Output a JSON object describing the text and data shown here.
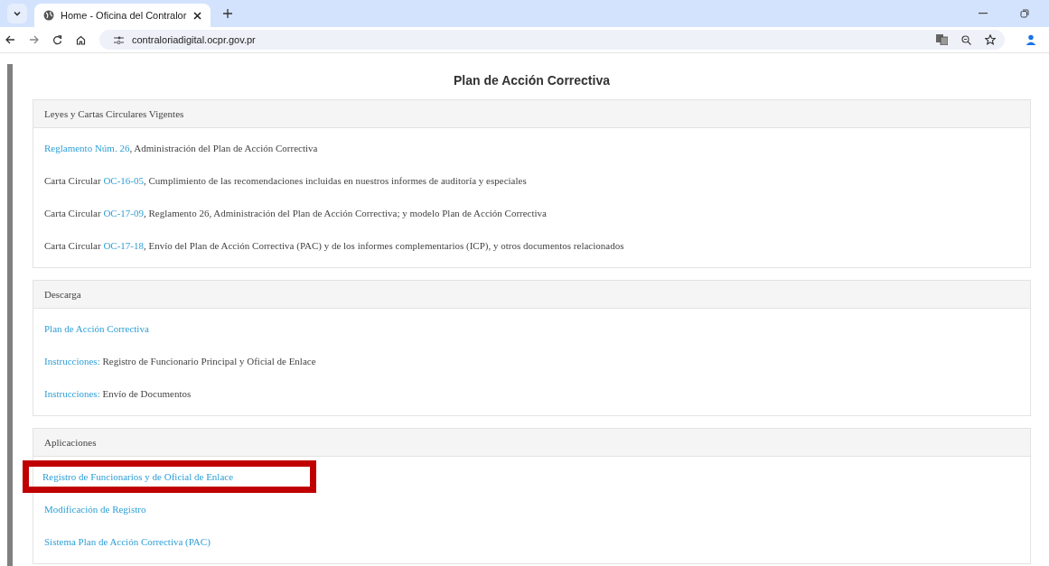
{
  "browser": {
    "tab": {
      "title": "Home - Oficina del Contralor",
      "selected": true
    },
    "url": "contraloriadigital.ocpr.gov.pr"
  },
  "page_title": "Plan de Acción Correctiva",
  "sections": [
    {
      "heading": "Leyes y Cartas Circulares Vigentes",
      "items": [
        {
          "link": "Reglamento Núm. 26",
          "text": ", Administración del Plan de Acción Correctiva",
          "highlighted": false
        },
        {
          "prefix": "Carta Circular ",
          "link": "OC-16-05",
          "text": ", Cumplimiento de las recomendaciones incluidas en nuestros informes de auditoría  y especiales",
          "highlighted": false
        },
        {
          "prefix": "Carta Circular ",
          "link": "OC-17-09",
          "text": ", Reglamento 26, Administración del Plan de Acción Correctiva; y modelo Plan de Acción Correctiva",
          "highlighted": false
        },
        {
          "prefix": "Carta Circular ",
          "link": "OC-17-18",
          "text": ", Envío del Plan de Acción Correctiva (PAC) y de los informes complementarios (ICP), y otros documentos relacionados",
          "highlighted": false
        }
      ]
    },
    {
      "heading": "Descarga",
      "items": [
        {
          "link": "Plan de Acción Correctiva",
          "highlighted": false
        },
        {
          "link": "Instrucciones:",
          "text": " Registro de Funcionario Principal y Oficial de Enlace",
          "highlighted": false
        },
        {
          "link": "Instrucciones:",
          "text": " Envío de Documentos",
          "highlighted": false
        }
      ]
    },
    {
      "heading": "Aplicaciones",
      "items": [
        {
          "link": "Registro de Funcionarios y de Oficial de Enlace",
          "highlighted": true
        },
        {
          "link": "Modificación de Registro",
          "highlighted": false
        },
        {
          "link": "Sistema Plan de Acción Correctiva (PAC)",
          "highlighted": false
        }
      ]
    }
  ]
}
